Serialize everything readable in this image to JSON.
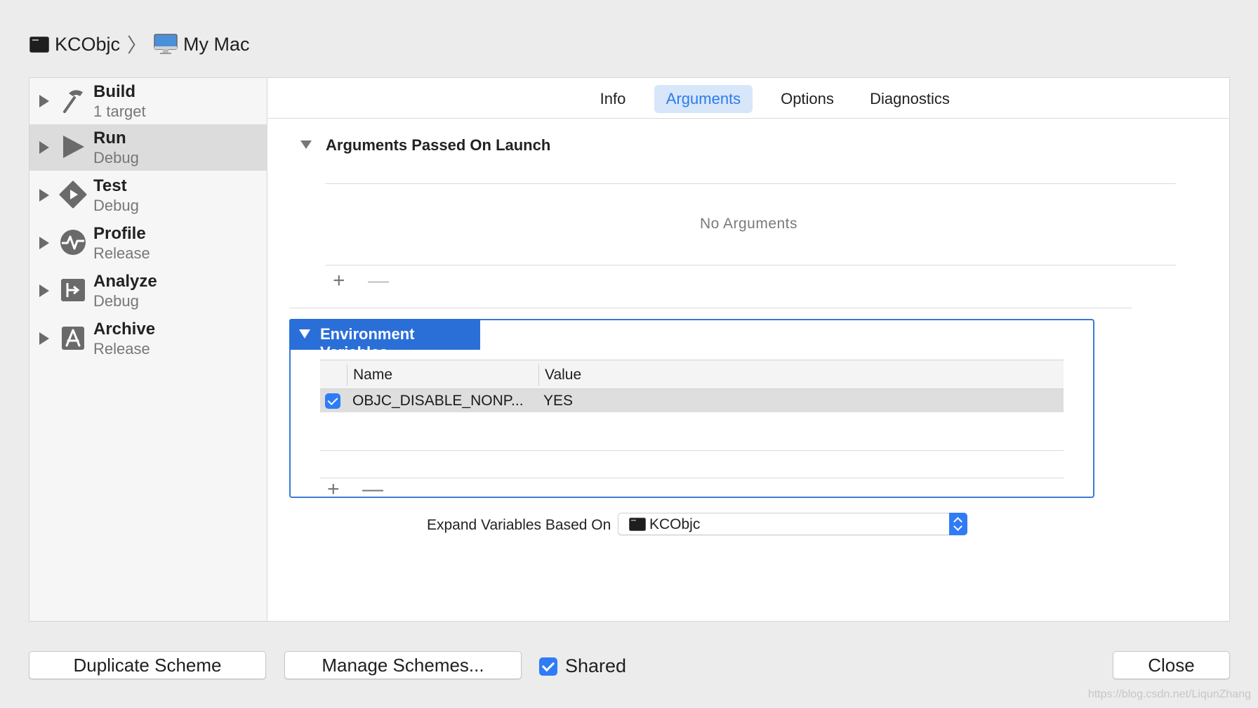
{
  "breadcrumb": {
    "project": "KCObjc",
    "destination": "My Mac"
  },
  "sidebar": {
    "items": [
      {
        "title": "Build",
        "subtitle": "1 target",
        "icon": "hammer-icon"
      },
      {
        "title": "Run",
        "subtitle": "Debug",
        "icon": "play-icon",
        "selected": true
      },
      {
        "title": "Test",
        "subtitle": "Debug",
        "icon": "test-diamond-icon"
      },
      {
        "title": "Profile",
        "subtitle": "Release",
        "icon": "waveform-icon"
      },
      {
        "title": "Analyze",
        "subtitle": "Debug",
        "icon": "analyze-icon"
      },
      {
        "title": "Archive",
        "subtitle": "Release",
        "icon": "archive-icon"
      }
    ]
  },
  "tabs": [
    {
      "label": "Info"
    },
    {
      "label": "Arguments",
      "active": true
    },
    {
      "label": "Options"
    },
    {
      "label": "Diagnostics"
    }
  ],
  "arguments_section": {
    "title": "Arguments Passed On Launch",
    "empty_text": "No Arguments",
    "add": "+",
    "remove": "—"
  },
  "env_section": {
    "title": "Environment Variables",
    "columns": [
      "Name",
      "Value"
    ],
    "rows": [
      {
        "checked": true,
        "name": "OBJC_DISABLE_NONP...",
        "value": "YES"
      }
    ],
    "add": "+",
    "remove": "—"
  },
  "expand": {
    "label": "Expand Variables Based On",
    "selected": "KCObjc"
  },
  "footer": {
    "duplicate": "Duplicate Scheme",
    "manage": "Manage Schemes...",
    "shared_label": "Shared",
    "shared_checked": true,
    "close": "Close"
  },
  "watermark": "https://blog.csdn.net/LiqunZhang",
  "colors": {
    "accent": "#2f7cf6",
    "env_header": "#2a6fd8",
    "tab_active_bg": "#d8e6fa",
    "tab_active_text": "#2b7cf0"
  }
}
